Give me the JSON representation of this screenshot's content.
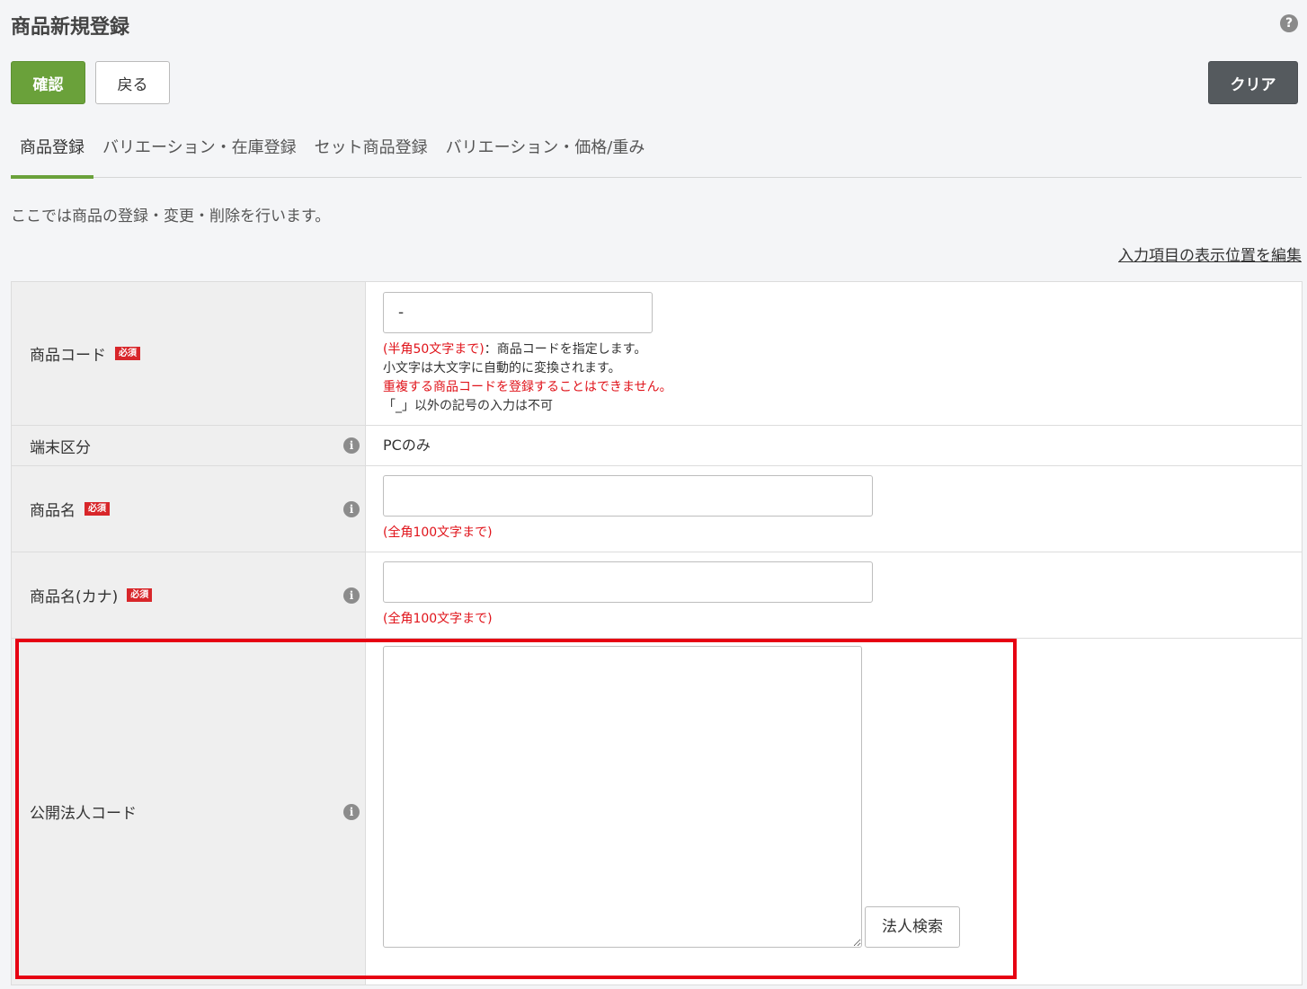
{
  "page": {
    "title": "商品新規登録",
    "help_icon": "?"
  },
  "toolbar": {
    "confirm_label": "確認",
    "back_label": "戻る",
    "clear_label": "クリア"
  },
  "tabs": [
    {
      "label": "商品登録",
      "active": true
    },
    {
      "label": "バリエーション・在庫登録",
      "active": false
    },
    {
      "label": "セット商品登録",
      "active": false
    },
    {
      "label": "バリエーション・価格/重み",
      "active": false
    }
  ],
  "description": "ここでは商品の登録・変更・削除を行います。",
  "edit_link": "入力項目の表示位置を編集",
  "required_badge": "必須",
  "info_icon": "i",
  "form": {
    "product_code": {
      "label": "商品コード",
      "value": "-",
      "note_red_1": "(半角50文字まで)",
      "note_1": "：商品コードを指定します。",
      "note_2": "小文字は大文字に自動的に変換されます。",
      "note_red_2": "重複する商品コードを登録することはできません。",
      "note_3": "「_」以外の記号の入力は不可"
    },
    "terminal": {
      "label": "端末区分",
      "value": "PCのみ"
    },
    "product_name": {
      "label": "商品名",
      "value": "",
      "note": "(全角100文字まで)"
    },
    "product_name_kana": {
      "label": "商品名(カナ)",
      "value": "",
      "note": "(全角100文字まで)"
    },
    "public_corp_code": {
      "label": "公開法人コード",
      "value": "",
      "search_button": "法人検索"
    }
  },
  "colors": {
    "accent_green": "#6aa13a",
    "dark_button": "#555a5e",
    "required_red": "#d8262a",
    "note_red": "#e0131a",
    "highlight_red": "#e60012"
  }
}
